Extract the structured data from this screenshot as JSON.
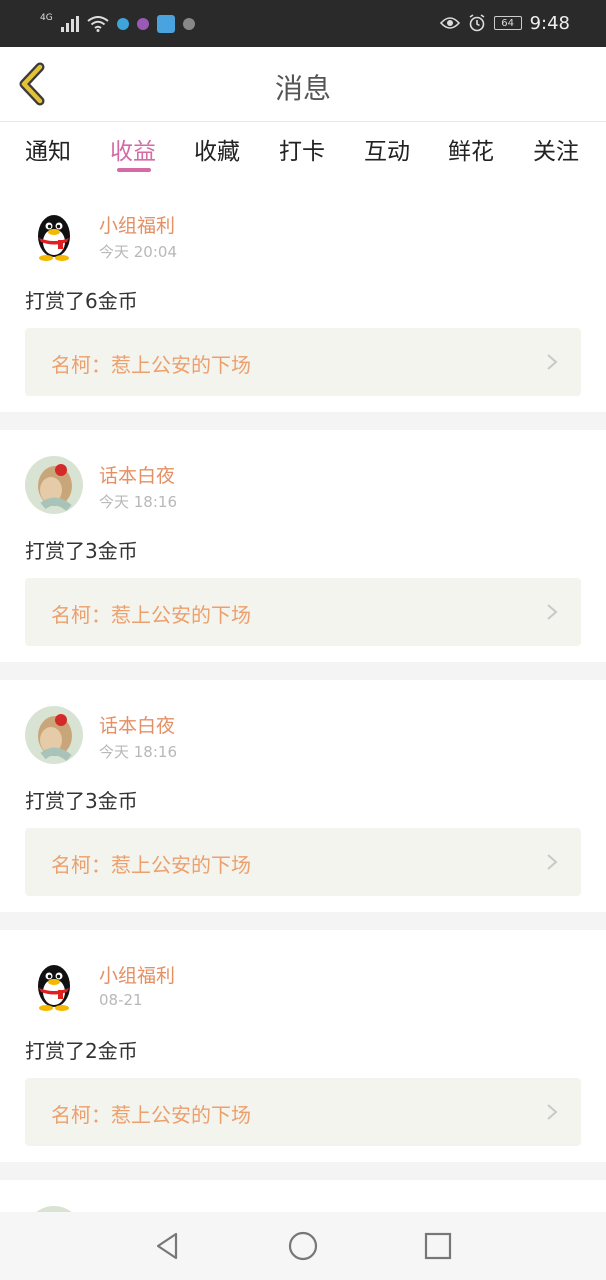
{
  "status_bar": {
    "network": "4G",
    "time": "9:48",
    "battery": "64"
  },
  "header": {
    "title": "消息"
  },
  "tabs": [
    {
      "label": "通知",
      "active": false
    },
    {
      "label": "收益",
      "active": true
    },
    {
      "label": "收藏",
      "active": false
    },
    {
      "label": "打卡",
      "active": false
    },
    {
      "label": "互动",
      "active": false
    },
    {
      "label": "鲜花",
      "active": false
    },
    {
      "label": "关注",
      "active": false
    }
  ],
  "messages": [
    {
      "user": "小组福利",
      "avatar": "penguin-avatar",
      "time": "今天 20:04",
      "text": "打赏了6金币",
      "link": "名柯：惹上公安的下场"
    },
    {
      "user": "话本白夜",
      "avatar": "girl-photo-avatar",
      "time": "今天 18:16",
      "text": "打赏了3金币",
      "link": "名柯：惹上公安的下场"
    },
    {
      "user": "话本白夜",
      "avatar": "girl-photo-avatar",
      "time": "今天 18:16",
      "text": "打赏了3金币",
      "link": "名柯：惹上公安的下场"
    },
    {
      "user": "小组福利",
      "avatar": "penguin-avatar",
      "time": "08-21",
      "text": "打赏了2金币",
      "link": "名柯：惹上公安的下场"
    }
  ],
  "colors": {
    "accent": "#d46aa6",
    "username": "#e58f63",
    "link_text": "#eba06e",
    "link_bg": "#f4f4ee",
    "back_arrow": "#e3c23a"
  },
  "nav": [
    "back-triangle-icon",
    "home-circle-icon",
    "recents-square-icon"
  ]
}
